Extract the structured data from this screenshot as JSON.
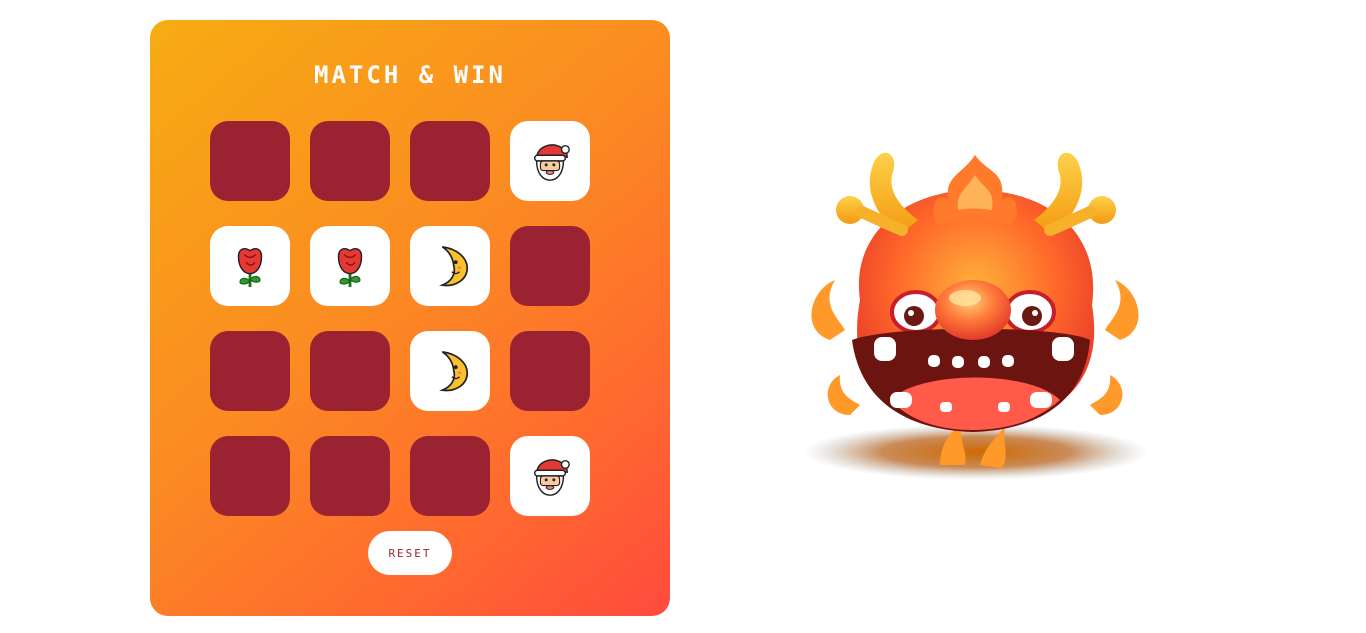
{
  "game": {
    "title": "MATCH & WIN",
    "reset_label": "RESET"
  },
  "cards": [
    {
      "state": "hidden"
    },
    {
      "state": "hidden"
    },
    {
      "state": "hidden"
    },
    {
      "state": "revealed",
      "emoji": "🎅",
      "icon": "santa-icon"
    },
    {
      "state": "revealed",
      "emoji": "🌹",
      "icon": "rose-icon"
    },
    {
      "state": "revealed",
      "emoji": "🌹",
      "icon": "rose-icon"
    },
    {
      "state": "revealed",
      "emoji": "🌛",
      "icon": "crescent-moon-face-icon"
    },
    {
      "state": "hidden"
    },
    {
      "state": "hidden"
    },
    {
      "state": "hidden"
    },
    {
      "state": "revealed",
      "emoji": "🌛",
      "icon": "crescent-moon-face-icon"
    },
    {
      "state": "hidden"
    },
    {
      "state": "hidden"
    },
    {
      "state": "hidden"
    },
    {
      "state": "hidden"
    },
    {
      "state": "revealed",
      "emoji": "🎅",
      "icon": "santa-icon"
    }
  ],
  "colors": {
    "panel_gradient": [
      "#f7ac12",
      "#ff4a3d"
    ],
    "card_back": "#9b2230",
    "card_face": "#ffffff"
  },
  "mascot": {
    "icon": "fire-dragon-mascot-icon"
  }
}
